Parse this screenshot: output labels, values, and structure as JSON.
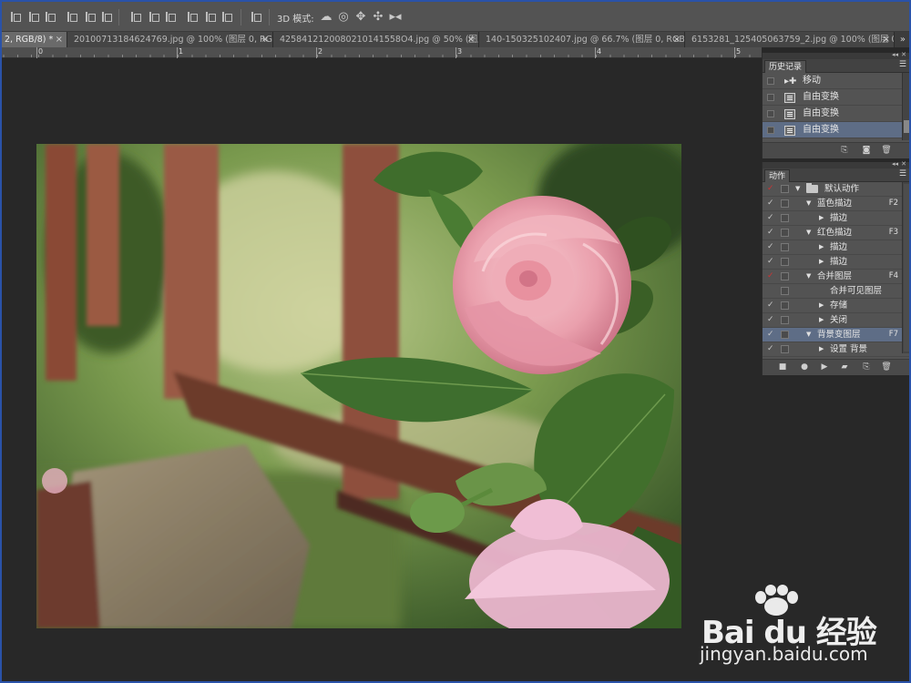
{
  "options_bar": {
    "mode_label": "3D 模式:"
  },
  "tabs": [
    {
      "label": "2, RGB/8) *",
      "active": true
    },
    {
      "label": "20100713184624769.jpg @ 100% (图层 0, RGB..."
    },
    {
      "label": "4258412120080210141558O4.jpg @ 50% (图层 0, ..."
    },
    {
      "label": "140-150325102407.jpg @ 66.7% (图层 0, RGB/..."
    },
    {
      "label": "6153281_125405063759_2.jpg @ 100% (图层 0, ..."
    }
  ],
  "ruler": {
    "numbers": [
      "0",
      "1",
      "2",
      "3",
      "4",
      "5"
    ]
  },
  "history_panel": {
    "tab_label": "历史记录",
    "items": [
      {
        "label": "移动",
        "icon": "move-tool-icon"
      },
      {
        "label": "自由变换",
        "icon": "history-state-icon"
      },
      {
        "label": "自由变换",
        "icon": "history-state-icon"
      },
      {
        "label": "自由变换",
        "icon": "history-state-icon",
        "selected": true
      }
    ],
    "scroll_fraction": 0.85
  },
  "actions_panel": {
    "tab_label": "动作",
    "rows": [
      {
        "check": "✓",
        "red": true,
        "level": 0,
        "expanded": true,
        "folder": true,
        "label": "默认动作",
        "key": ""
      },
      {
        "check": "✓",
        "red": false,
        "level": 1,
        "expanded": true,
        "label": "蓝色描边",
        "key": "F2"
      },
      {
        "check": "✓",
        "red": false,
        "level": 2,
        "expanded": false,
        "label": "描边",
        "key": ""
      },
      {
        "check": "✓",
        "red": false,
        "level": 1,
        "expanded": true,
        "label": "红色描边",
        "key": "F3"
      },
      {
        "check": "✓",
        "red": false,
        "level": 2,
        "expanded": false,
        "label": "描边",
        "key": ""
      },
      {
        "check": "✓",
        "red": false,
        "level": 2,
        "expanded": false,
        "label": "描边",
        "key": ""
      },
      {
        "check": "✓",
        "red": true,
        "level": 1,
        "expanded": true,
        "label": "合并图层",
        "key": "F4"
      },
      {
        "check": "",
        "red": false,
        "level": 2,
        "noarrow": true,
        "label": "合并可见图层",
        "key": ""
      },
      {
        "check": "✓",
        "red": false,
        "level": 2,
        "expanded": false,
        "label": "存储",
        "key": ""
      },
      {
        "check": "✓",
        "red": false,
        "level": 2,
        "expanded": false,
        "label": "关闭",
        "key": ""
      },
      {
        "check": "✓",
        "red": false,
        "level": 1,
        "expanded": true,
        "label": "背景变图层",
        "key": "F7",
        "selected": true
      },
      {
        "check": "✓",
        "red": false,
        "level": 2,
        "expanded": false,
        "label": "设置 背景",
        "key": ""
      }
    ]
  },
  "watermark": {
    "logo_text": "Bai du 经验",
    "url": "jingyan.baidu.com"
  },
  "colors": {
    "window_frame": "#2a52a8",
    "workspace": "#282828",
    "panel": "#535353",
    "selection": "#5e6d86"
  }
}
